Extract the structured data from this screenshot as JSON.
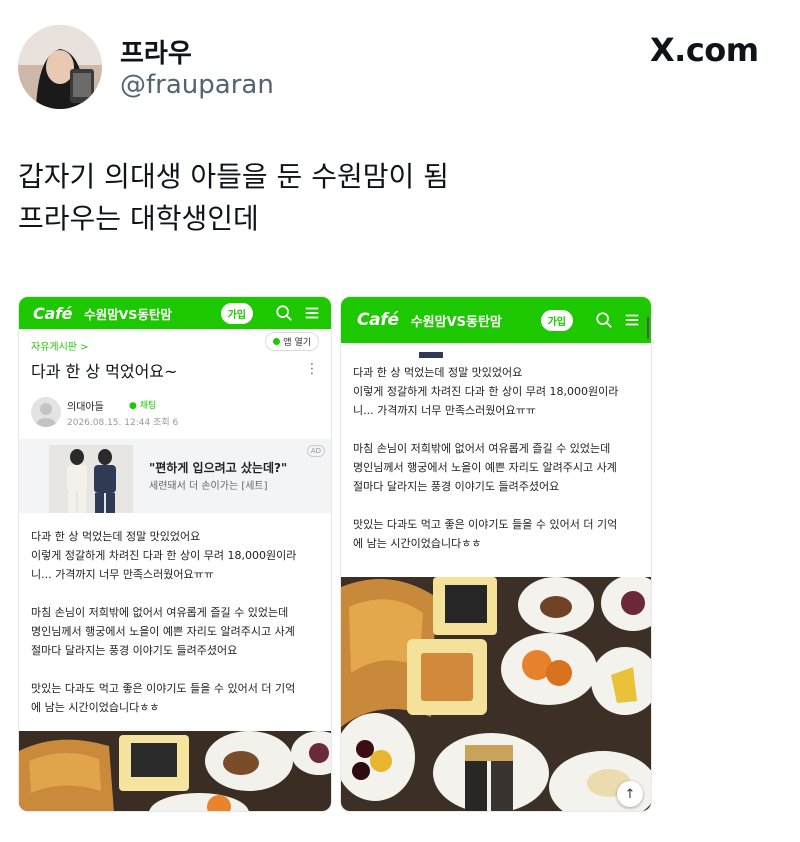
{
  "tweet": {
    "display_name": "프라우",
    "handle": "@frauparan",
    "brand": "X.com",
    "text_line1": "갑자기 의대생 아들을 둔 수원맘이 됨",
    "text_line2": "프라우는 대학생인데"
  },
  "cafe": {
    "logo": "Café",
    "name": "수원맘VS동탄맘",
    "join_label": "가입",
    "icons": [
      "search-icon",
      "menu-icon"
    ]
  },
  "post": {
    "board": "자유게시판 >",
    "app_open": "앱 열기",
    "title": "다과 한 상 먹었어요~",
    "author": "의대아들",
    "chat_label": "채팅",
    "meta": "2026.08.15. 12:44  조회 6",
    "paragraphs": [
      [
        "다과 한 상 먹었는데 정말 맛있었어요",
        "이렇게 정갈하게 차려진 다과 한 상이 무려 18,000원이라",
        "니... 가격까지 너무 만족스러웠어요ㅠㅠ"
      ],
      [
        "마침 손님이 저희밖에 없어서 여유롭게 즐길 수 있었는데",
        "명인님께서 행궁에서 노을이 예쁜 자리도 알려주시고 사계",
        "절마다 달라지는 풍경 이야기도 들려주셨어요"
      ],
      [
        "맛있는 다과도 먹고 좋은 이야기도 들을 수 있어서 더 기억",
        "에 남는 시간이었습니다ㅎㅎ"
      ]
    ]
  },
  "ad": {
    "title": "\"편하게 입으려고 샀는데?\"",
    "subtitle": "세련돼서 더 손이가는 [세트]",
    "tag": "AD"
  },
  "scroll_top_icon": "arrow-up-icon",
  "colors": {
    "cafe_green": "#1ec800",
    "text": "#0f1419",
    "handle_gray": "#536471"
  }
}
